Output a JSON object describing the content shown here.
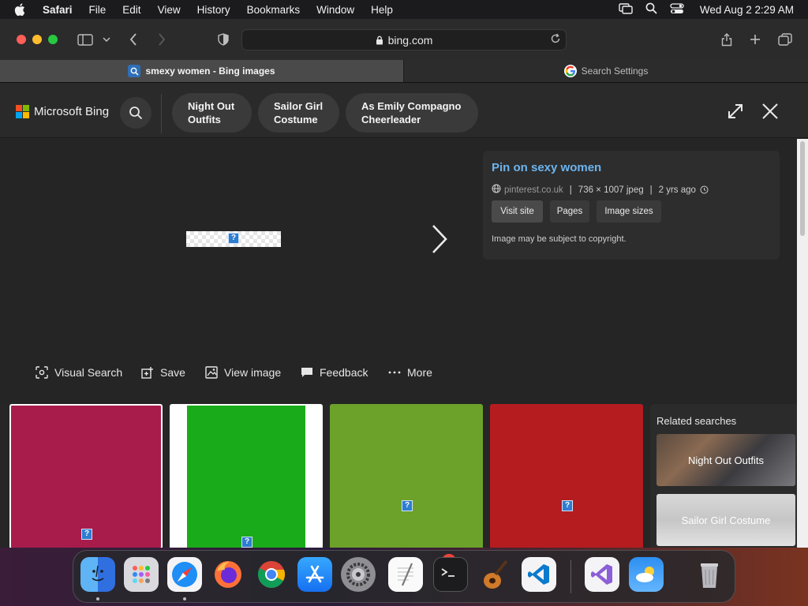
{
  "menubar": {
    "items": [
      {
        "label": "Safari",
        "bold": true
      },
      {
        "label": "File"
      },
      {
        "label": "Edit"
      },
      {
        "label": "View"
      },
      {
        "label": "History"
      },
      {
        "label": "Bookmarks"
      },
      {
        "label": "Window"
      },
      {
        "label": "Help"
      }
    ],
    "clock": "Wed Aug 2  2:29 AM"
  },
  "toolbar": {
    "address": "bing.com"
  },
  "tabs": [
    {
      "label": "smexy women - Bing images",
      "active": true
    },
    {
      "label": "Search Settings",
      "active": false
    }
  ],
  "bing": {
    "logo_text": "Microsoft Bing",
    "pills": [
      {
        "line1": "Night Out",
        "line2": "Outfits"
      },
      {
        "line1": "Sailor Girl",
        "line2": "Costume"
      },
      {
        "line1": "As Emily Compagno",
        "line2": "Cheerleader"
      }
    ]
  },
  "info": {
    "title": "Pin on sexy women",
    "source": "pinterest.co.uk",
    "dimensions": "736 × 1007 jpeg",
    "age": "2 yrs ago",
    "buttons": [
      "Visit site",
      "Pages",
      "Image sizes"
    ],
    "note": "Image may be subject to copyright."
  },
  "actions": [
    {
      "label": "Visual Search",
      "icon": "visual-search-icon"
    },
    {
      "label": "Save",
      "icon": "save-icon"
    },
    {
      "label": "View image",
      "icon": "view-image-icon"
    },
    {
      "label": "Feedback",
      "icon": "feedback-icon"
    },
    {
      "label": "More",
      "icon": "more-icon"
    }
  ],
  "grid": {
    "colors": [
      "#a81c4c",
      "#1aab1a",
      "#6ca229",
      "#b51c20"
    ]
  },
  "related": {
    "title": "Related searches",
    "items": [
      "Night Out Outfits",
      "Sailor Girl Costume"
    ]
  },
  "colors": {
    "bing_link": "#6cb4ee",
    "ms_red": "#f25022",
    "ms_green": "#7fba00",
    "ms_blue": "#00a4ef",
    "ms_yellow": "#ffb900"
  },
  "dock": {
    "apps": [
      "finder-icon",
      "launchpad-icon",
      "safari-icon",
      "firefox-icon",
      "chrome-icon",
      "app-store-icon",
      "system-settings-icon",
      "textedit-icon",
      "terminal-icon",
      "garageband-icon",
      "vscode-icon",
      "visual-studio-icon",
      "weather-icon",
      "trash-icon"
    ],
    "settings_badge": "1"
  }
}
